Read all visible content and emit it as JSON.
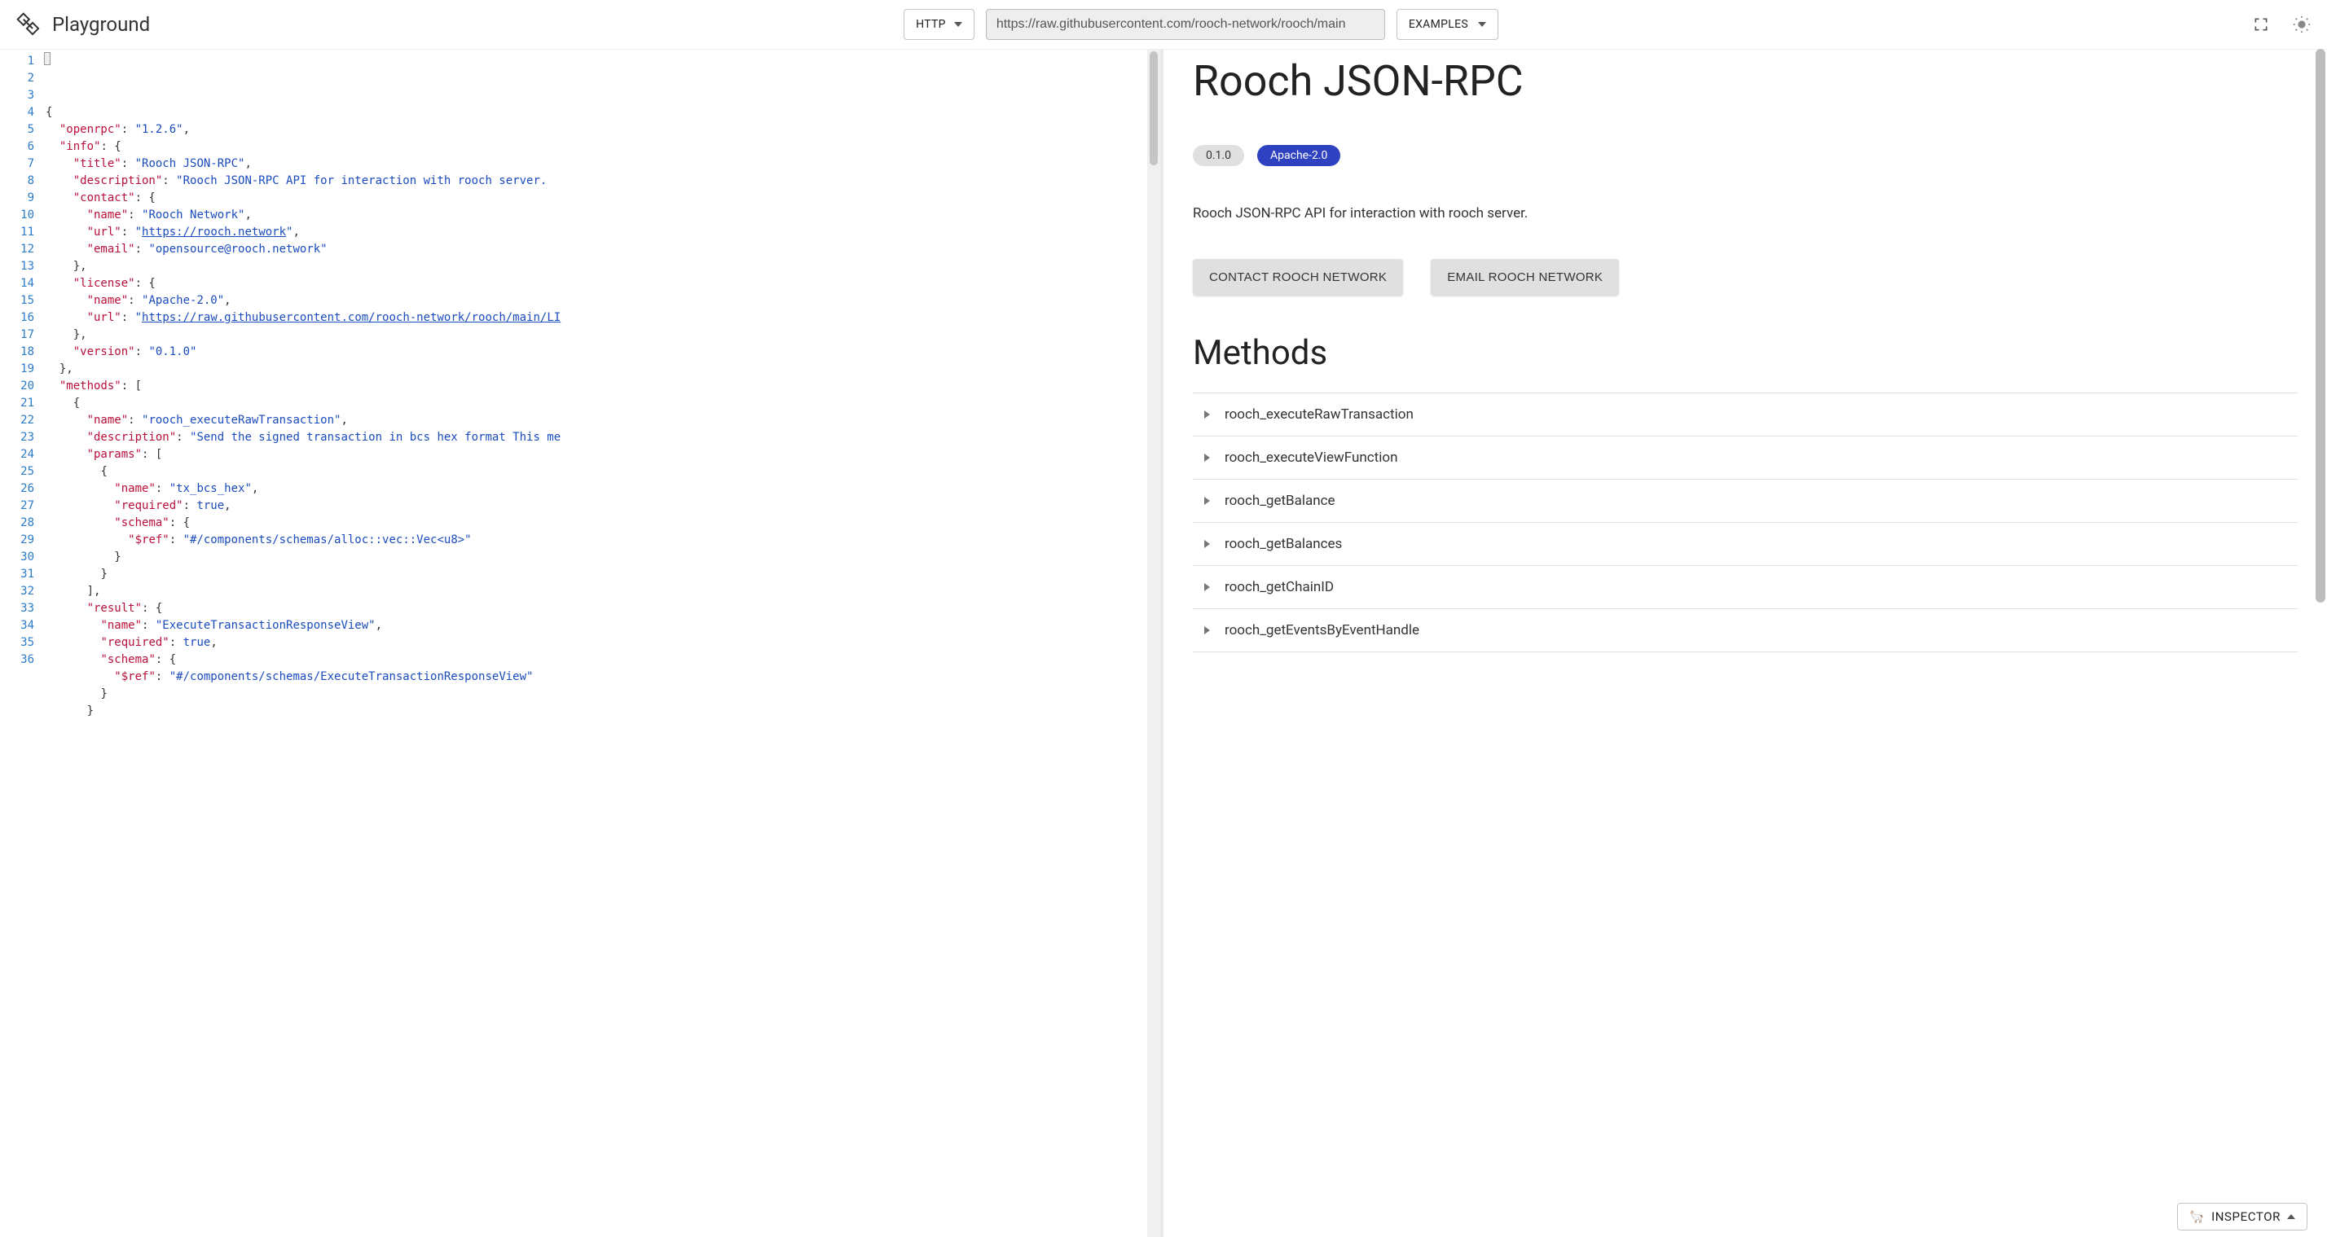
{
  "header": {
    "title": "Playground",
    "protocol": "HTTP",
    "url": "https://raw.githubusercontent.com/rooch-network/rooch/main",
    "examples_label": "EXAMPLES"
  },
  "editor": {
    "line_count": 36,
    "lines": [
      {
        "tokens": [
          {
            "t": "{",
            "c": "p"
          }
        ]
      },
      {
        "indent": 1,
        "tokens": [
          {
            "t": "\"openrpc\"",
            "c": "k"
          },
          {
            "t": ": ",
            "c": "p"
          },
          {
            "t": "\"1.2.6\"",
            "c": "s"
          },
          {
            "t": ",",
            "c": "p"
          }
        ]
      },
      {
        "indent": 1,
        "tokens": [
          {
            "t": "\"info\"",
            "c": "k"
          },
          {
            "t": ": {",
            "c": "p"
          }
        ]
      },
      {
        "indent": 2,
        "tokens": [
          {
            "t": "\"title\"",
            "c": "k"
          },
          {
            "t": ": ",
            "c": "p"
          },
          {
            "t": "\"Rooch JSON-RPC\"",
            "c": "s"
          },
          {
            "t": ",",
            "c": "p"
          }
        ]
      },
      {
        "indent": 2,
        "tokens": [
          {
            "t": "\"description\"",
            "c": "k"
          },
          {
            "t": ": ",
            "c": "p"
          },
          {
            "t": "\"Rooch JSON-RPC API for interaction with rooch server. ",
            "c": "s"
          }
        ]
      },
      {
        "indent": 2,
        "tokens": [
          {
            "t": "\"contact\"",
            "c": "k"
          },
          {
            "t": ": {",
            "c": "p"
          }
        ]
      },
      {
        "indent": 3,
        "tokens": [
          {
            "t": "\"name\"",
            "c": "k"
          },
          {
            "t": ": ",
            "c": "p"
          },
          {
            "t": "\"Rooch Network\"",
            "c": "s"
          },
          {
            "t": ",",
            "c": "p"
          }
        ]
      },
      {
        "indent": 3,
        "tokens": [
          {
            "t": "\"url\"",
            "c": "k"
          },
          {
            "t": ": ",
            "c": "p"
          },
          {
            "t": "\"",
            "c": "s"
          },
          {
            "t": "https://rooch.network",
            "c": "s",
            "u": true
          },
          {
            "t": "\"",
            "c": "s"
          },
          {
            "t": ",",
            "c": "p"
          }
        ]
      },
      {
        "indent": 3,
        "tokens": [
          {
            "t": "\"email\"",
            "c": "k"
          },
          {
            "t": ": ",
            "c": "p"
          },
          {
            "t": "\"opensource@rooch.network\"",
            "c": "s"
          }
        ]
      },
      {
        "indent": 2,
        "tokens": [
          {
            "t": "},",
            "c": "p"
          }
        ]
      },
      {
        "indent": 2,
        "tokens": [
          {
            "t": "\"license\"",
            "c": "k"
          },
          {
            "t": ": {",
            "c": "p"
          }
        ]
      },
      {
        "indent": 3,
        "tokens": [
          {
            "t": "\"name\"",
            "c": "k"
          },
          {
            "t": ": ",
            "c": "p"
          },
          {
            "t": "\"Apache-2.0\"",
            "c": "s"
          },
          {
            "t": ",",
            "c": "p"
          }
        ]
      },
      {
        "indent": 3,
        "tokens": [
          {
            "t": "\"url\"",
            "c": "k"
          },
          {
            "t": ": ",
            "c": "p"
          },
          {
            "t": "\"",
            "c": "s"
          },
          {
            "t": "https://raw.githubusercontent.com/rooch-network/rooch/main/LI",
            "c": "s",
            "u": true
          }
        ]
      },
      {
        "indent": 2,
        "tokens": [
          {
            "t": "},",
            "c": "p"
          }
        ]
      },
      {
        "indent": 2,
        "tokens": [
          {
            "t": "\"version\"",
            "c": "k"
          },
          {
            "t": ": ",
            "c": "p"
          },
          {
            "t": "\"0.1.0\"",
            "c": "s"
          }
        ]
      },
      {
        "indent": 1,
        "tokens": [
          {
            "t": "},",
            "c": "p"
          }
        ]
      },
      {
        "indent": 1,
        "tokens": [
          {
            "t": "\"methods\"",
            "c": "k"
          },
          {
            "t": ": [",
            "c": "p"
          }
        ]
      },
      {
        "indent": 2,
        "tokens": [
          {
            "t": "{",
            "c": "p"
          }
        ]
      },
      {
        "indent": 3,
        "tokens": [
          {
            "t": "\"name\"",
            "c": "k"
          },
          {
            "t": ": ",
            "c": "p"
          },
          {
            "t": "\"rooch_executeRawTransaction\"",
            "c": "s"
          },
          {
            "t": ",",
            "c": "p"
          }
        ]
      },
      {
        "indent": 3,
        "tokens": [
          {
            "t": "\"description\"",
            "c": "k"
          },
          {
            "t": ": ",
            "c": "p"
          },
          {
            "t": "\"Send the signed transaction in bcs hex format This me",
            "c": "s"
          }
        ]
      },
      {
        "indent": 3,
        "tokens": [
          {
            "t": "\"params\"",
            "c": "k"
          },
          {
            "t": ": [",
            "c": "p"
          }
        ]
      },
      {
        "indent": 4,
        "tokens": [
          {
            "t": "{",
            "c": "p"
          }
        ]
      },
      {
        "indent": 5,
        "tokens": [
          {
            "t": "\"name\"",
            "c": "k"
          },
          {
            "t": ": ",
            "c": "p"
          },
          {
            "t": "\"tx_bcs_hex\"",
            "c": "s"
          },
          {
            "t": ",",
            "c": "p"
          }
        ]
      },
      {
        "indent": 5,
        "tokens": [
          {
            "t": "\"required\"",
            "c": "k"
          },
          {
            "t": ": ",
            "c": "p"
          },
          {
            "t": "true",
            "c": "n"
          },
          {
            "t": ",",
            "c": "p"
          }
        ]
      },
      {
        "indent": 5,
        "tokens": [
          {
            "t": "\"schema\"",
            "c": "k"
          },
          {
            "t": ": {",
            "c": "p"
          }
        ]
      },
      {
        "indent": 6,
        "tokens": [
          {
            "t": "\"$ref\"",
            "c": "k"
          },
          {
            "t": ": ",
            "c": "p"
          },
          {
            "t": "\"#/components/schemas/alloc::vec::Vec<u8>\"",
            "c": "s"
          }
        ]
      },
      {
        "indent": 5,
        "tokens": [
          {
            "t": "}",
            "c": "p"
          }
        ]
      },
      {
        "indent": 4,
        "tokens": [
          {
            "t": "}",
            "c": "p"
          }
        ]
      },
      {
        "indent": 3,
        "tokens": [
          {
            "t": "],",
            "c": "p"
          }
        ]
      },
      {
        "indent": 3,
        "tokens": [
          {
            "t": "\"result\"",
            "c": "k"
          },
          {
            "t": ": {",
            "c": "p"
          }
        ]
      },
      {
        "indent": 4,
        "tokens": [
          {
            "t": "\"name\"",
            "c": "k"
          },
          {
            "t": ": ",
            "c": "p"
          },
          {
            "t": "\"ExecuteTransactionResponseView\"",
            "c": "s"
          },
          {
            "t": ",",
            "c": "p"
          }
        ]
      },
      {
        "indent": 4,
        "tokens": [
          {
            "t": "\"required\"",
            "c": "k"
          },
          {
            "t": ": ",
            "c": "p"
          },
          {
            "t": "true",
            "c": "n"
          },
          {
            "t": ",",
            "c": "p"
          }
        ]
      },
      {
        "indent": 4,
        "tokens": [
          {
            "t": "\"schema\"",
            "c": "k"
          },
          {
            "t": ": {",
            "c": "p"
          }
        ]
      },
      {
        "indent": 5,
        "tokens": [
          {
            "t": "\"$ref\"",
            "c": "k"
          },
          {
            "t": ": ",
            "c": "p"
          },
          {
            "t": "\"#/components/schemas/ExecuteTransactionResponseView\"",
            "c": "s"
          }
        ]
      },
      {
        "indent": 4,
        "tokens": [
          {
            "t": "}",
            "c": "p"
          }
        ]
      },
      {
        "indent": 3,
        "tokens": [
          {
            "t": "}",
            "c": "p"
          }
        ]
      }
    ]
  },
  "doc": {
    "title": "Rooch JSON-RPC",
    "version_badge": "0.1.0",
    "license_badge": "Apache-2.0",
    "description": "Rooch JSON-RPC API for interaction with rooch server.",
    "contact_button": "CONTACT ROOCH NETWORK",
    "email_button": "EMAIL ROOCH NETWORK",
    "methods_heading": "Methods",
    "methods": [
      "rooch_executeRawTransaction",
      "rooch_executeViewFunction",
      "rooch_getBalance",
      "rooch_getBalances",
      "rooch_getChainID",
      "rooch_getEventsByEventHandle"
    ]
  },
  "inspector": {
    "label": "INSPECTOR",
    "emoji": "🦙"
  }
}
